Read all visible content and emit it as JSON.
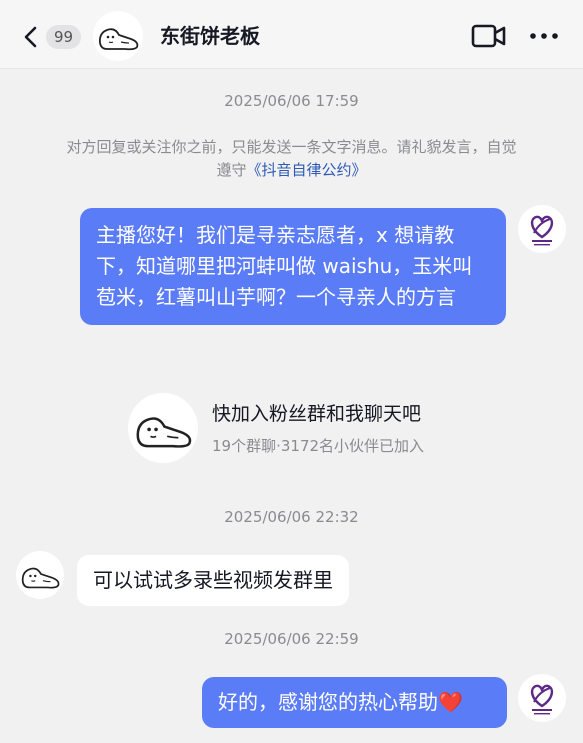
{
  "header": {
    "unread_count": "99",
    "contact_name": "东街饼老板"
  },
  "messages": {
    "ts1": "2025/06/06 17:59",
    "notice_text": "对方回复或关注你之前，只能发送一条文字消息。请礼貌发言，自觉遵守",
    "notice_link": "《抖音自律公约》",
    "sent1": "主播您好！我们是寻亲志愿者，x 想请教下，知道哪里把河蚌叫做 waishu，玉米叫苞米，红薯叫山芋啊？一个寻亲人的方言",
    "group_card": {
      "title": "快加入粉丝群和我聊天吧",
      "subtitle": "19个群聊·3172名小伙伴已加入"
    },
    "ts2": "2025/06/06 22:32",
    "received1": "可以试试多录些视频发群里",
    "ts3": "2025/06/06 22:59",
    "sent2": "好的，感谢您的热心帮助❤️"
  },
  "colors": {
    "sent_bubble": "#5b7cf7",
    "received_bubble": "#ffffff",
    "background": "#f1f1f1",
    "link": "#2f5bb7",
    "volunteer_logo": "#5b2a86"
  }
}
